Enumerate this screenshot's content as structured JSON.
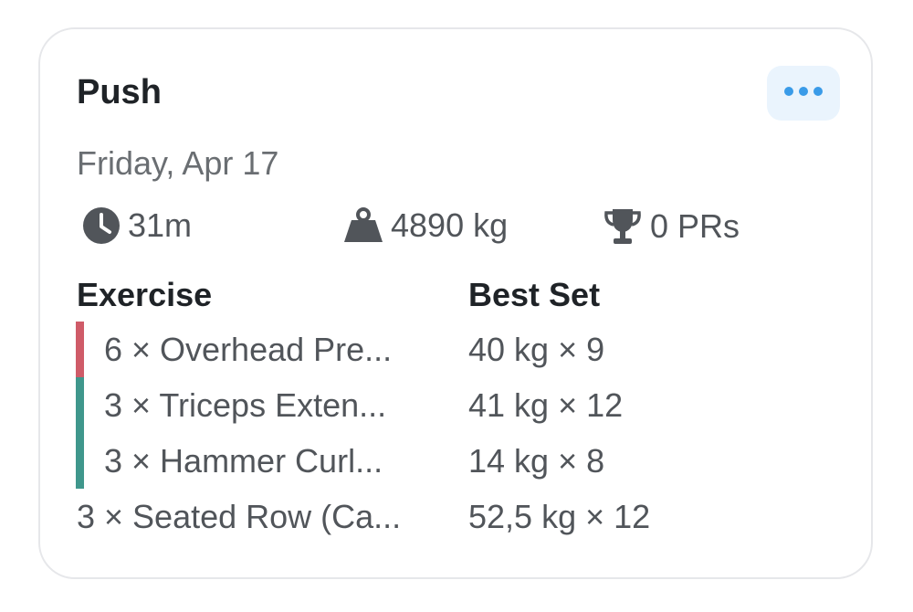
{
  "workout": {
    "title": "Push",
    "date": "Friday, Apr 17"
  },
  "stats": {
    "duration": "31m",
    "volume": "4890 kg",
    "prs": "0 PRs"
  },
  "table": {
    "col_exercise": "Exercise",
    "col_best_set": "Best Set",
    "rows": [
      {
        "exercise": "6 × Overhead Pre...",
        "best_set": "40 kg × 9",
        "group_color": "#cf5b68"
      },
      {
        "exercise": "3 × Triceps Exten...",
        "best_set": "41 kg × 12",
        "group_color": "#3f978c"
      },
      {
        "exercise": "3 × Hammer Curl...",
        "best_set": "14 kg × 8",
        "group_color": "#3f978c"
      },
      {
        "exercise": "3 × Seated Row (Ca...",
        "best_set": "52,5 kg × 12",
        "group_color": ""
      }
    ]
  },
  "icons": {
    "more": "ellipsis-icon",
    "duration": "clock-icon",
    "volume": "weight-icon",
    "prs": "trophy-icon"
  },
  "colors": {
    "accent": "#3a9be8",
    "superset_red": "#cf5b68",
    "superset_teal": "#3f978c"
  }
}
